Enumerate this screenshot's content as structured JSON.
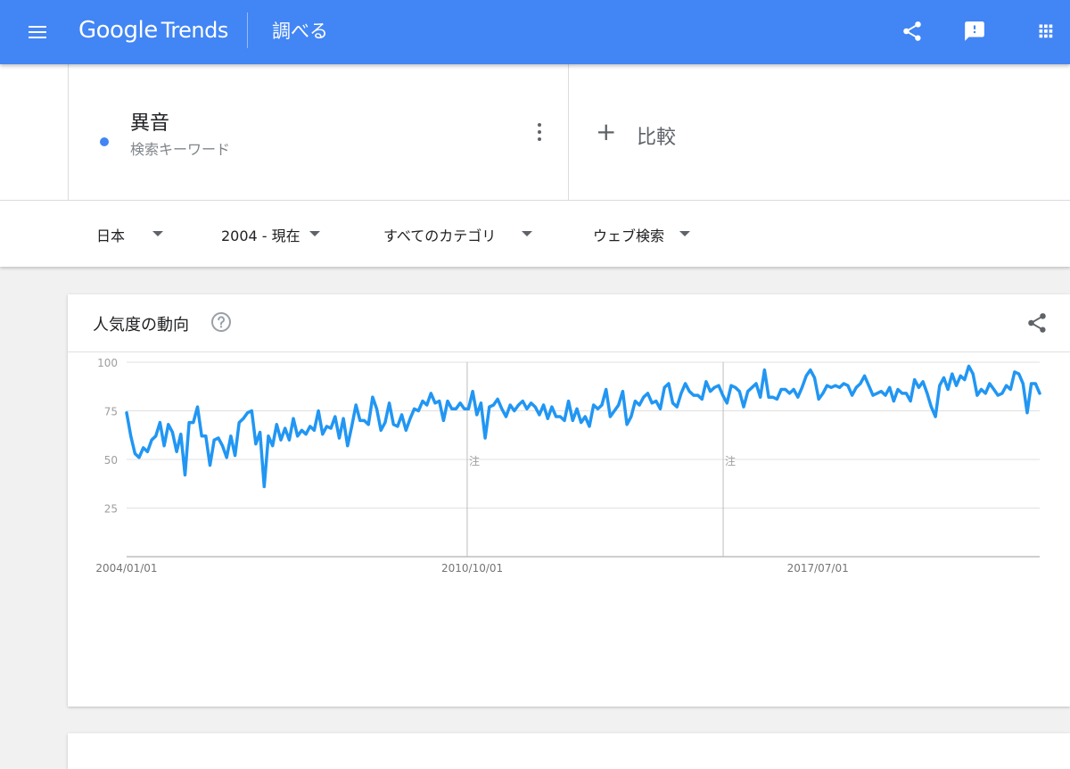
{
  "header": {
    "logo_google": "Google",
    "logo_trends": "Trends",
    "page_title": "調べる",
    "icons": [
      "menu-icon",
      "share-icon",
      "feedback-icon",
      "apps-icon"
    ],
    "bar_color": "#4285f4"
  },
  "keyword": {
    "term": "異音",
    "type": "検索キーワード",
    "dot_color": "#4285f4",
    "compare_plus": "+",
    "compare_label": "比較"
  },
  "filters": [
    {
      "label": "日本"
    },
    {
      "label": "2004 - 現在"
    },
    {
      "label": "すべてのカテゴリ"
    },
    {
      "label": "ウェブ検索"
    }
  ],
  "card": {
    "title": "人気度の動向",
    "help_icon": "help-circle-icon",
    "share_icon": "share-icon"
  },
  "chart_data": {
    "type": "line",
    "title": "",
    "xlabel": "",
    "ylabel": "",
    "ylim": [
      0,
      100
    ],
    "yticks": [
      25,
      50,
      75,
      100
    ],
    "grid": true,
    "line_color": "#2196f3",
    "x_tick_labels": [
      "2004/01/01",
      "2010/10/01",
      "2017/07/01"
    ],
    "x_range": [
      "2004/01/01",
      "2021/11/01"
    ],
    "annotations": [
      {
        "date": "2011/01/01",
        "label": "注"
      },
      {
        "date": "2016/01/01",
        "label": "注"
      }
    ],
    "series": [
      {
        "start": "2004/01",
        "interval": "month",
        "values": [
          74,
          62,
          53,
          51,
          56,
          54,
          60,
          62,
          69,
          57,
          68,
          64,
          54,
          63,
          42,
          69,
          69,
          77,
          62,
          62,
          47,
          60,
          61,
          57,
          51,
          62,
          52,
          69,
          71,
          74,
          75,
          58,
          64,
          36,
          62,
          57,
          68,
          60,
          66,
          60,
          71,
          62,
          65,
          63,
          67,
          65,
          75,
          63,
          67,
          66,
          72,
          61,
          71,
          57,
          67,
          78,
          70,
          70,
          68,
          82,
          76,
          65,
          69,
          79,
          68,
          67,
          73,
          65,
          71,
          76,
          75,
          80,
          78,
          84,
          79,
          80,
          70,
          80,
          76,
          76,
          79,
          76,
          76,
          85,
          73,
          79,
          61,
          77,
          78,
          81,
          76,
          72,
          78,
          75,
          78,
          80,
          76,
          79,
          77,
          73,
          78,
          71,
          77,
          72,
          72,
          70,
          80,
          70,
          76,
          69,
          72,
          67,
          78,
          76,
          78,
          86,
          72,
          75,
          78,
          85,
          68,
          72,
          80,
          78,
          82,
          84,
          79,
          80,
          76,
          87,
          89,
          79,
          77,
          84,
          89,
          85,
          83,
          83,
          81,
          90,
          85,
          87,
          88,
          83,
          79,
          88,
          87,
          85,
          77,
          85,
          87,
          89,
          82,
          96,
          82,
          82,
          81,
          86,
          86,
          84,
          86,
          82,
          87,
          93,
          96,
          92,
          81,
          84,
          88,
          87,
          88,
          87,
          89,
          88,
          83,
          87,
          89,
          93,
          88,
          83,
          84,
          85,
          83,
          87,
          80,
          86,
          84,
          84,
          80,
          91,
          87,
          90,
          84,
          77,
          72,
          88,
          92,
          86,
          94,
          88,
          93,
          91,
          98,
          94,
          83,
          86,
          84,
          89,
          86,
          83,
          84,
          88,
          86,
          95,
          94,
          89,
          74,
          89,
          89,
          84
        ]
      }
    ]
  }
}
